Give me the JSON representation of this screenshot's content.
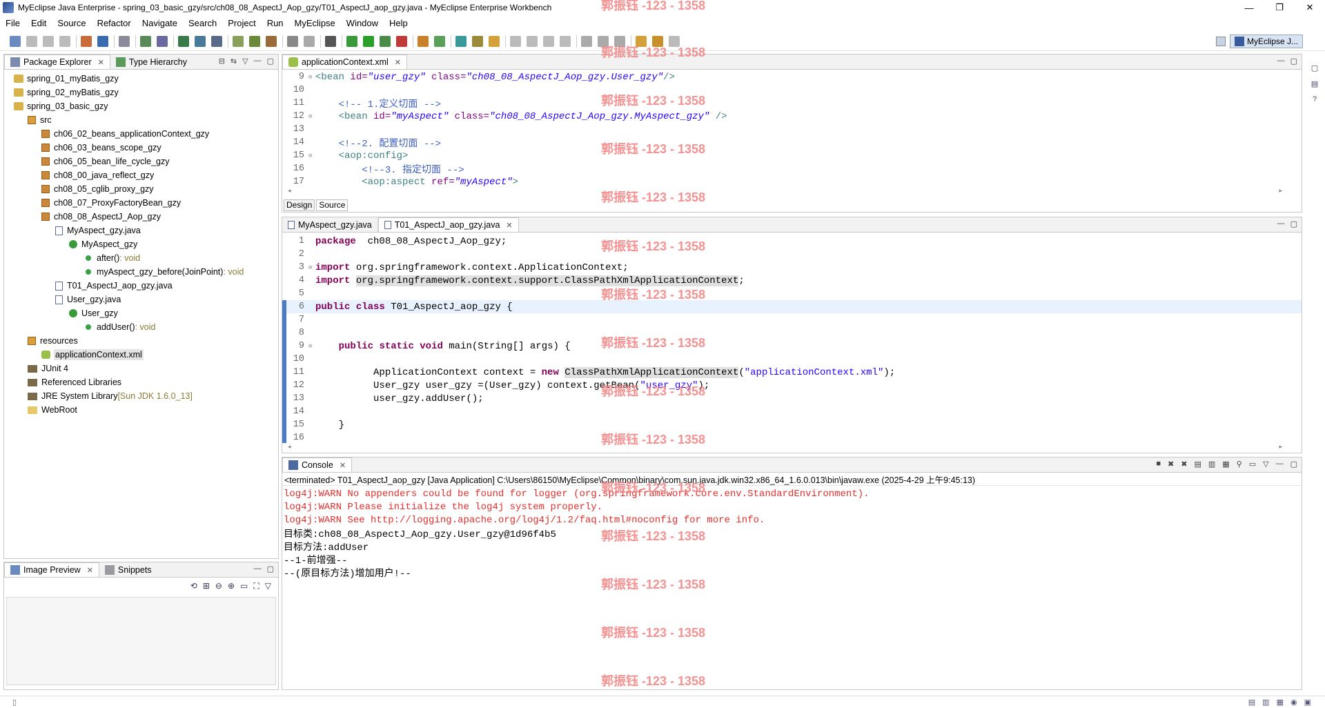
{
  "window": {
    "title": "MyEclipse Java Enterprise - spring_03_basic_gzy/src/ch08_08_AspectJ_Aop_gzy/T01_AspectJ_aop_gzy.java - MyEclipse Enterprise Workbench",
    "minimize": "—",
    "maximize": "❐",
    "close": "✕"
  },
  "menu": [
    "File",
    "Edit",
    "Source",
    "Refactor",
    "Navigate",
    "Search",
    "Project",
    "Run",
    "MyEclipse",
    "Window",
    "Help"
  ],
  "perspective": {
    "label": "MyEclipse J..."
  },
  "package_explorer": {
    "tabs": {
      "explorer": "Package Explorer",
      "hierarchy": "Type Hierarchy"
    },
    "tree": [
      {
        "text": "spring_01_myBatis_gzy"
      },
      {
        "text": "spring_02_myBatis_gzy"
      },
      {
        "text": "spring_03_basic_gzy"
      },
      {
        "text": "src"
      },
      {
        "text": "ch06_02_beans_applicationContext_gzy"
      },
      {
        "text": "ch06_03_beans_scope_gzy"
      },
      {
        "text": "ch06_05_bean_life_cycle_gzy"
      },
      {
        "text": "ch08_00_java_reflect_gzy"
      },
      {
        "text": "ch08_05_cglib_proxy_gzy"
      },
      {
        "text": "ch08_07_ProxyFactoryBean_gzy"
      },
      {
        "text": "ch08_08_AspectJ_Aop_gzy"
      },
      {
        "text": "MyAspect_gzy.java"
      },
      {
        "text": "MyAspect_gzy"
      },
      {
        "text": "after()",
        "suffix": " : void"
      },
      {
        "text": "myAspect_gzy_before(JoinPoint)",
        "suffix": " : void"
      },
      {
        "text": "T01_AspectJ_aop_gzy.java"
      },
      {
        "text": "User_gzy.java"
      },
      {
        "text": "User_gzy"
      },
      {
        "text": "addUser()",
        "suffix": " : void"
      },
      {
        "text": "resources"
      },
      {
        "text": "applicationContext.xml"
      },
      {
        "text": "JUnit 4"
      },
      {
        "text": "Referenced Libraries"
      },
      {
        "text": "JRE System Library",
        "suffix": " [Sun JDK 1.6.0_13]"
      },
      {
        "text": "WebRoot"
      }
    ]
  },
  "image_preview": {
    "tabs": {
      "preview": "Image Preview",
      "snippets": "Snippets"
    }
  },
  "xml_editor": {
    "tab": "applicationContext.xml",
    "design": "Design",
    "source": "Source",
    "lines": [
      {
        "n": "9",
        "parts": [
          [
            "tag",
            "<bean "
          ],
          [
            "attr",
            "id="
          ],
          [
            "strit",
            "\"user_gzy\""
          ],
          [
            "attr",
            " class="
          ],
          [
            "strit",
            "\"ch08_08_AspectJ_Aop_gzy.User_gzy\""
          ],
          [
            "tag",
            "/>"
          ]
        ]
      },
      {
        "n": "10",
        "parts": []
      },
      {
        "n": "11",
        "parts": [
          [
            "cmt",
            "    <!-- 1.定义切面 -->"
          ]
        ]
      },
      {
        "n": "12",
        "parts": [
          [
            "tag",
            "    <bean "
          ],
          [
            "attr",
            "id="
          ],
          [
            "strit",
            "\"myAspect\""
          ],
          [
            "attr",
            " class="
          ],
          [
            "strit",
            "\"ch08_08_AspectJ_Aop_gzy.MyAspect_gzy\""
          ],
          [
            "tag",
            " />"
          ]
        ]
      },
      {
        "n": "13",
        "parts": []
      },
      {
        "n": "14",
        "parts": [
          [
            "cmt",
            "    <!--2. 配置切面 -->"
          ]
        ]
      },
      {
        "n": "15",
        "parts": [
          [
            "tag",
            "    <aop:config>"
          ]
        ]
      },
      {
        "n": "16",
        "parts": [
          [
            "cmt",
            "        <!--3. 指定切面 -->"
          ]
        ]
      },
      {
        "n": "17",
        "parts": [
          [
            "tag",
            "        <aop:aspect "
          ],
          [
            "attr",
            "ref="
          ],
          [
            "strit",
            "\"myAspect\""
          ],
          [
            "tag",
            ">"
          ]
        ]
      }
    ]
  },
  "java_editor": {
    "tabs": {
      "aspect": "MyAspect_gzy.java",
      "main": "T01_AspectJ_aop_gzy.java"
    },
    "lines": [
      {
        "n": "1",
        "parts": [
          [
            "kw",
            "package"
          ],
          [
            "",
            "  ch08_08_AspectJ_Aop_gzy;"
          ]
        ]
      },
      {
        "n": "2",
        "parts": []
      },
      {
        "n": "3",
        "parts": [
          [
            "kw",
            "import"
          ],
          [
            "",
            " org.springframework.context.ApplicationContext;"
          ]
        ]
      },
      {
        "n": "4",
        "parts": [
          [
            "kw",
            "import"
          ],
          [
            "",
            " "
          ],
          [
            "sel",
            "org.springframework.context.support.ClassPathXmlApplicationContext"
          ],
          [
            "",
            ";"
          ]
        ]
      },
      {
        "n": "5",
        "parts": []
      },
      {
        "n": "6",
        "parts": [
          [
            "kw",
            "public"
          ],
          [
            "",
            " "
          ],
          [
            "kw",
            "class"
          ],
          [
            "",
            " T01_AspectJ_aop_gzy {"
          ]
        ]
      },
      {
        "n": "7",
        "parts": []
      },
      {
        "n": "8",
        "parts": []
      },
      {
        "n": "9",
        "parts": [
          [
            "",
            "    "
          ],
          [
            "kw",
            "public"
          ],
          [
            "",
            " "
          ],
          [
            "kw",
            "static"
          ],
          [
            "",
            " "
          ],
          [
            "kw",
            "void"
          ],
          [
            "",
            " main(String[] args) {"
          ]
        ]
      },
      {
        "n": "10",
        "parts": []
      },
      {
        "n": "11",
        "parts": [
          [
            "",
            "          ApplicationContext context = "
          ],
          [
            "kw",
            "new"
          ],
          [
            "",
            " "
          ],
          [
            "sel",
            "ClassPathXmlApplicationContext"
          ],
          [
            "",
            "("
          ],
          [
            "str",
            "\"applicationContext.xml\""
          ],
          [
            "",
            ");"
          ]
        ]
      },
      {
        "n": "12",
        "parts": [
          [
            "",
            "          User_gzy user_gzy =(User_gzy) context.getBean("
          ],
          [
            "str",
            "\"user_gzy\""
          ],
          [
            "",
            ");"
          ]
        ]
      },
      {
        "n": "13",
        "parts": [
          [
            "",
            "          user_gzy.addUser();"
          ]
        ]
      },
      {
        "n": "14",
        "parts": []
      },
      {
        "n": "15",
        "parts": [
          [
            "",
            "    }"
          ]
        ]
      },
      {
        "n": "16",
        "parts": []
      }
    ]
  },
  "console": {
    "tab": "Console",
    "header": "<terminated> T01_AspectJ_aop_gzy [Java Application] C:\\Users\\86150\\MyEclipse\\Common\\binary\\com.sun.java.jdk.win32.x86_64_1.6.0.013\\bin\\javaw.exe (2025-4-29 上午9:45:13)",
    "lines": [
      {
        "kind": "warn",
        "text": "log4j:WARN No appenders could be found for logger (org.springframework.core.env.StandardEnvironment)."
      },
      {
        "kind": "warn",
        "text": "log4j:WARN Please initialize the log4j system properly."
      },
      {
        "kind": "warn",
        "text": "log4j:WARN See http://logging.apache.org/log4j/1.2/faq.html#noconfig for more info."
      },
      {
        "kind": "out",
        "text": "目标类:ch08_08_AspectJ_Aop_gzy.User_gzy@1d96f4b5"
      },
      {
        "kind": "out",
        "text": "目标方法:addUser"
      },
      {
        "kind": "out",
        "text": "--1-前增强--"
      },
      {
        "kind": "out",
        "text": "--(原目标方法)增加用户!--"
      }
    ]
  },
  "watermark": "郭振钰 -123 - 1358",
  "colors": {
    "keyword": "#7f0055",
    "string": "#2a00ff",
    "comment": "#3f5fbf",
    "warn": "#e03030",
    "watermark": "#f08080"
  }
}
